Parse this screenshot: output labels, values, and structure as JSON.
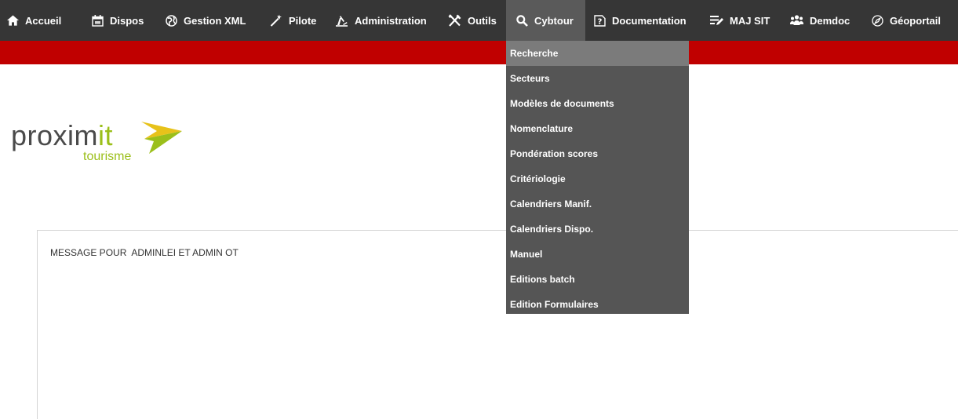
{
  "colors": {
    "topbar": "#363636",
    "accent_band": "#c00000",
    "dropdown_bg": "#555555",
    "dropdown_active": "#7b7b7b",
    "logo_green": "#9bbf1a"
  },
  "nav": {
    "items": [
      {
        "label": "Accueil",
        "icon": "home-icon"
      },
      {
        "label": "Dispos",
        "icon": "calendar-icon"
      },
      {
        "label": "Gestion XML",
        "icon": "globe-icon"
      },
      {
        "label": "Pilote",
        "icon": "magic-wand-icon"
      },
      {
        "label": "Administration",
        "icon": "admin-icon"
      },
      {
        "label": "Outils",
        "icon": "tools-icon"
      },
      {
        "label": "Cybtour",
        "icon": "search-icon",
        "active": true
      },
      {
        "label": "Documentation",
        "icon": "help-document-icon"
      },
      {
        "label": "MAJ SIT",
        "icon": "edit-list-icon"
      },
      {
        "label": "Demdoc",
        "icon": "people-icon"
      },
      {
        "label": "Géoportail",
        "icon": "compass-icon"
      }
    ]
  },
  "dropdown": {
    "items": [
      {
        "label": "Recherche",
        "active": true
      },
      {
        "label": "Secteurs"
      },
      {
        "label": "Modèles de documents"
      },
      {
        "label": "Nomenclature"
      },
      {
        "label": "Pondération scores"
      },
      {
        "label": "Critériologie"
      },
      {
        "label": "Calendriers Manif."
      },
      {
        "label": "Calendriers Dispo."
      },
      {
        "label": "Manuel"
      },
      {
        "label": "Editions batch"
      },
      {
        "label": "Edition Formulaires"
      }
    ]
  },
  "logo": {
    "word_prefix": "proxim",
    "word_suffix": "it",
    "tagline": "tourisme"
  },
  "message": "MESSAGE POUR  ADMINLEI ET ADMIN OT"
}
